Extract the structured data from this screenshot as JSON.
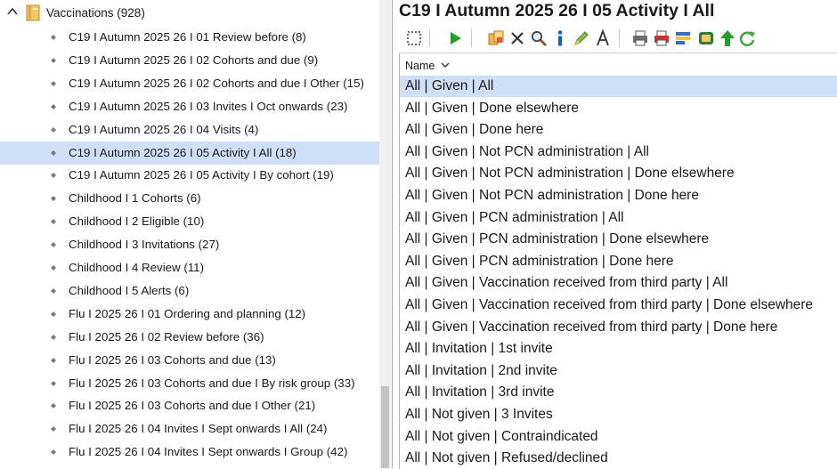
{
  "tree": {
    "root_label": "Vaccinations (928)",
    "items": [
      "C19 I Autumn 2025 26 I 01 Review before (8)",
      "C19 I Autumn 2025 26 I 02 Cohorts and due (9)",
      "C19 I Autumn 2025 26 I 02 Cohorts and due I Other (15)",
      "C19 I Autumn 2025 26 I 03 Invites I Oct onwards (23)",
      "C19 I Autumn 2025 26 I 04 Visits (4)",
      "C19 I Autumn 2025 26 I 05 Activity I All (18)",
      "C19 I Autumn 2025 26 I 05 Activity I By cohort (19)",
      "Childhood I 1 Cohorts (6)",
      "Childhood I 2 Eligible (10)",
      "Childhood I 3 Invitations (27)",
      "Childhood I 4 Review (11)",
      "Childhood I 5 Alerts (6)",
      "Flu I 2025 26 I 01 Ordering and planning (12)",
      "Flu I 2025 26 I 02 Review before (36)",
      "Flu I 2025 26 I 03 Cohorts and due (13)",
      "Flu I 2025 26 I 03 Cohorts and due I By risk group (33)",
      "Flu I 2025 26 I 03 Cohorts and due I Other (21)",
      "Flu I 2025 26 I 04 Invites I Sept onwards I All (24)",
      "Flu I 2025 26 I 04 Invites I Sept onwards I Group (42)"
    ],
    "selected_index": 5
  },
  "detail": {
    "title": "C19 I Autumn 2025 26 I 05 Activity I All",
    "column_header": "Name",
    "rows": [
      "All | Given | All",
      "All | Given | Done elsewhere",
      "All | Given | Done here",
      "All | Given | Not PCN administration | All",
      "All | Given | Not PCN administration | Done elsewhere",
      "All | Given | Not PCN administration | Done here",
      "All | Given | PCN administration | All",
      "All | Given | PCN administration | Done elsewhere",
      "All | Given | PCN administration | Done here",
      "All | Given | Vaccination received from third party | All",
      "All | Given | Vaccination received from third party | Done elsewhere",
      "All | Given | Vaccination received from third party | Done here",
      "All | Invitation | 1st invite",
      "All | Invitation | 2nd invite",
      "All | Invitation | 3rd invite",
      "All | Not given | 3 Invites",
      "All | Not given | Contraindicated",
      "All | Not given | Refused/declined"
    ],
    "selected_index": 0
  },
  "toolbar": {
    "icons": [
      "select-icon",
      "run-icon",
      "copy-icon",
      "delete-icon",
      "search-icon",
      "info-icon",
      "edit-icon",
      "font-icon",
      "print-icon",
      "print-red-icon",
      "report-icon",
      "database-icon",
      "upload-icon",
      "refresh-icon"
    ]
  },
  "colors": {
    "selection": "#cde0f7",
    "run_green": "#1fa12a",
    "info_blue": "#1565c0"
  }
}
